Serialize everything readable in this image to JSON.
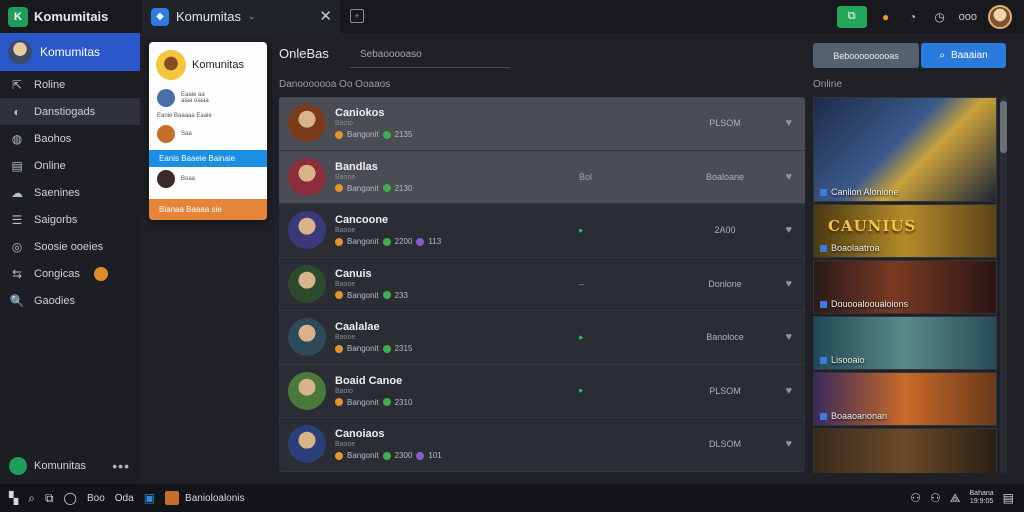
{
  "app": {
    "title": "Komumitais"
  },
  "tab": {
    "label": "Komumitas",
    "chevron": "⌄",
    "close": "✕"
  },
  "titlebar": {
    "green_button_icon": "⧉",
    "icons": [
      "fire-icon",
      "headset-icon",
      "clock-icon"
    ],
    "text": "ooo"
  },
  "sidebar": {
    "user_name": "Komumitas",
    "items": [
      {
        "icon": "⇱",
        "label": "Roline"
      },
      {
        "icon": "◐",
        "label": "Danstiogads"
      },
      {
        "icon": "◍",
        "label": "Baohos"
      },
      {
        "icon": "▤",
        "label": "Online"
      },
      {
        "icon": "☁",
        "label": "Saenines"
      },
      {
        "icon": "☰",
        "label": "Saigorbs"
      },
      {
        "icon": "◎",
        "label": "Soosie ooeies"
      },
      {
        "icon": "⇆",
        "label": "Congicas"
      },
      {
        "icon": "🔍",
        "label": "Gaodies"
      }
    ],
    "footer_label": "Komunitas",
    "footer_more": "•••"
  },
  "popup": {
    "title": "Komunitas",
    "rows": [
      {
        "line1": "Eaaie aa",
        "line2": "alaa oiaaa"
      },
      {
        "line1": "Eanie Baaaaa Eaaie",
        "line2": ""
      },
      {
        "line1": "Saa",
        "line2": ""
      }
    ],
    "selected": "Eanis Baaeie Bainaie",
    "row4": "Boaa",
    "footer": "Bianaa Baaaa sie"
  },
  "main": {
    "title": "OnleBas",
    "search_placeholder": "Sebaooooaso",
    "subhead": "Danooooooa  Oo Ooaaos",
    "online_label": "Online",
    "btn_grey": "Bebooooooooas",
    "btn_blue": "Baaaian"
  },
  "rows": [
    {
      "name": "Caniokos",
      "sub": "Baoio",
      "stat1": "Bangonit",
      "stat2": "2135",
      "stat3": "",
      "mid": "",
      "value": "PLSOM",
      "av": "#7a3b1b"
    },
    {
      "name": "Bandlas",
      "sub": "Baooe",
      "stat1": "Bangonit",
      "stat2": "2130",
      "stat3": "",
      "mid": "Bol",
      "value": "Boaloane",
      "av": "#8b2d3a"
    },
    {
      "name": "Cancoone",
      "sub": "Baooe",
      "stat1": "Bangonit",
      "stat2": "2200",
      "stat3": "113",
      "mid": "▸",
      "value": "2A00",
      "av": "#3a3a7a"
    },
    {
      "name": "Canuis",
      "sub": "Baooe",
      "stat1": "Bangonit",
      "stat2": "233",
      "stat3": "",
      "mid": "–",
      "value": "Donlone",
      "av": "#2c4a2c"
    },
    {
      "name": "Caalalae",
      "sub": "Baooe",
      "stat1": "Bangonit",
      "stat2": "2315",
      "stat3": "",
      "mid": "▸",
      "value": "Banoloce",
      "av": "#2d4a5a"
    },
    {
      "name": "Boaid Canoe",
      "sub": "Baoio",
      "stat1": "Bangonit",
      "stat2": "2310",
      "stat3": "",
      "mid": "▸",
      "value": "PLSOM",
      "av": "#4a7a3a"
    },
    {
      "name": "Canoiaos",
      "sub": "Baooe",
      "stat1": "Bangonit",
      "stat2": "2300",
      "stat3": "101",
      "mid": "",
      "value": "DLSOM",
      "av": "#2a3f7a"
    }
  ],
  "thumbs": [
    {
      "caption": "Canlion Alonione",
      "banner": "",
      "bg": "linear-gradient(135deg,#1d2b4a,#3b5a8a 45%,#c9a23a 60%,#1b2438)",
      "big": true
    },
    {
      "caption": "Boaolaatroa",
      "banner": "CAUNIUS",
      "bg": "linear-gradient(90deg,#4a3a12,#b58a2a 50%,#5a4516)",
      "big": false
    },
    {
      "caption": "Douooalooualoions",
      "banner": "",
      "bg": "linear-gradient(90deg,#2a1a1a,#7a3a22 45%,#2a1414)",
      "big": false
    },
    {
      "caption": "Lisooaio",
      "banner": "",
      "bg": "linear-gradient(90deg,#1f4a55,#5a8a8a 50%,#2a4a5a)",
      "big": false
    },
    {
      "caption": "Boaaoanonan",
      "banner": "",
      "bg": "linear-gradient(90deg,#3a2a5a,#c96a2a 50%,#6a3a1a)",
      "big": false
    },
    {
      "caption": "",
      "banner": "",
      "bg": "linear-gradient(90deg,#3a2a1a,#6a4a2a 50%,#2a1f14)",
      "big": false
    }
  ],
  "taskbar": {
    "items": [
      "Boo",
      "Oda"
    ],
    "app_label": "Banioloalonis",
    "time": "Bahana",
    "date": "19:9:05"
  },
  "colors": {
    "accent": "#2b7bdc",
    "brand": "#1f9d5b",
    "sidebar_active": "#2a57c9"
  }
}
